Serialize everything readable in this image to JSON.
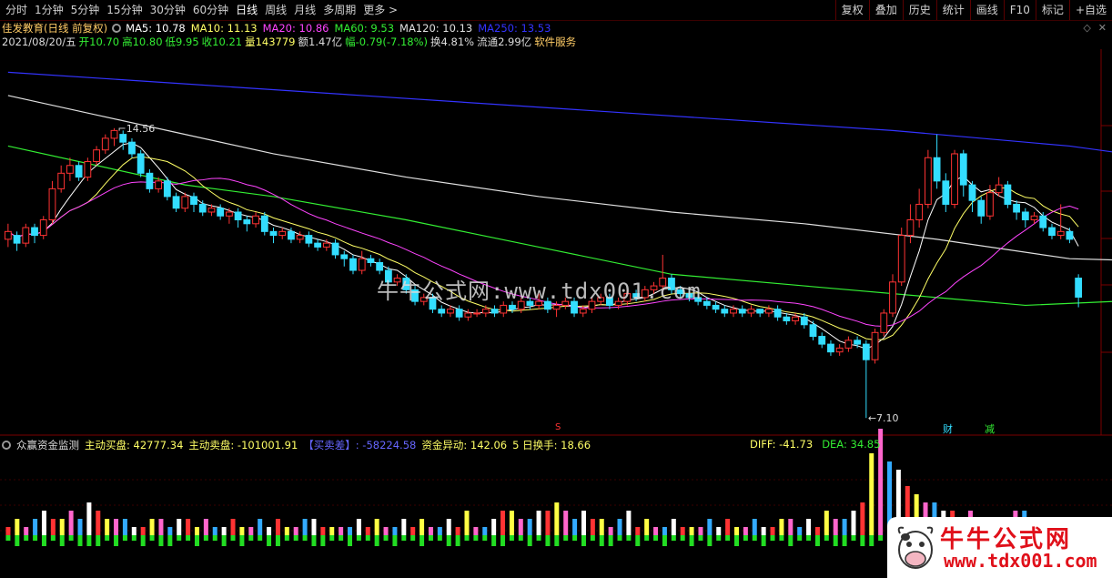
{
  "toolbar": {
    "periods": [
      "分时",
      "1分钟",
      "5分钟",
      "15分钟",
      "30分钟",
      "60分钟",
      "日线",
      "周线",
      "月线",
      "多周期",
      "更多 >"
    ],
    "active_period": "日线",
    "buttons": [
      "复权",
      "叠加",
      "历史",
      "统计",
      "画线",
      "F10",
      "标记",
      "+自选"
    ]
  },
  "stock": {
    "name": "佳发教育(日线 前复权)",
    "ma": [
      {
        "label": "MA5: 10.78",
        "color": "#ffffff"
      },
      {
        "label": "MA10: 11.13",
        "color": "#ffff66"
      },
      {
        "label": "MA20: 10.86",
        "color": "#ff44ff"
      },
      {
        "label": "MA60: 9.53",
        "color": "#33ee33"
      },
      {
        "label": "MA120: 10.13",
        "color": "#e0e0e0"
      },
      {
        "label": "MA250: 13.53",
        "color": "#3333ff"
      }
    ],
    "date": "2021/08/20/五",
    "open": "开10.70",
    "high": "高10.80",
    "low": "低9.95",
    "close": "收10.21",
    "volume": "量143779",
    "amount": "额1.47亿",
    "change": "幅-0.79(-7.18%)",
    "turnover": "换4.81%",
    "float": "流通2.99亿",
    "sector": "软件服务"
  },
  "annotations": {
    "high_label": "14.56",
    "low_label": "7.10",
    "marker_s": "S",
    "marker_bao": "财",
    "marker_jian": "减"
  },
  "watermark": "牛牛公式网:www.tdx001.com",
  "indicator": {
    "name": "众赢资金监测",
    "buy": "主动买盘: 42777.34",
    "sell": "主动卖盘: -101001.91",
    "diff_label": "【买卖差】: -58224.58",
    "flow": "资金异动: 142.06",
    "turnover5": "5 日换手: 18.66",
    "diff": "DIFF: -41.73",
    "dea": "DEA: 34.85"
  },
  "logo": {
    "brand": "牛牛公式网",
    "url": "www.tdx001.com"
  },
  "colors": {
    "up": "#ff3333",
    "down": "#33ddff",
    "ma5": "#ffffff",
    "ma10": "#ffff66",
    "ma20": "#ff44ff",
    "ma60": "#33ee33",
    "ma120": "#e0e0e0",
    "ma250": "#3333ff"
  },
  "chart_data": {
    "type": "candlestick",
    "price_range": [
      6.8,
      16.5
    ],
    "candles": [
      {
        "o": 11.7,
        "c": 11.9,
        "h": 12.1,
        "l": 11.5
      },
      {
        "o": 11.8,
        "c": 11.6,
        "h": 11.9,
        "l": 11.4
      },
      {
        "o": 11.6,
        "c": 12.0,
        "h": 12.1,
        "l": 11.5
      },
      {
        "o": 12.0,
        "c": 11.8,
        "h": 12.1,
        "l": 11.6
      },
      {
        "o": 11.8,
        "c": 12.2,
        "h": 12.3,
        "l": 11.7
      },
      {
        "o": 12.2,
        "c": 13.0,
        "h": 13.2,
        "l": 12.1
      },
      {
        "o": 13.0,
        "c": 13.4,
        "h": 13.6,
        "l": 12.9
      },
      {
        "o": 13.4,
        "c": 13.6,
        "h": 13.8,
        "l": 13.2
      },
      {
        "o": 13.6,
        "c": 13.3,
        "h": 13.7,
        "l": 13.2
      },
      {
        "o": 13.3,
        "c": 13.7,
        "h": 13.8,
        "l": 13.2
      },
      {
        "o": 13.7,
        "c": 14.0,
        "h": 14.1,
        "l": 13.6
      },
      {
        "o": 14.0,
        "c": 14.3,
        "h": 14.4,
        "l": 13.9
      },
      {
        "o": 14.3,
        "c": 14.5,
        "h": 14.56,
        "l": 14.1
      },
      {
        "o": 14.4,
        "c": 14.2,
        "h": 14.5,
        "l": 14.0
      },
      {
        "o": 14.2,
        "c": 13.9,
        "h": 14.3,
        "l": 13.8
      },
      {
        "o": 13.9,
        "c": 13.4,
        "h": 14.0,
        "l": 13.3
      },
      {
        "o": 13.4,
        "c": 13.0,
        "h": 13.5,
        "l": 12.9
      },
      {
        "o": 13.0,
        "c": 13.2,
        "h": 13.3,
        "l": 12.9
      },
      {
        "o": 13.2,
        "c": 12.8,
        "h": 13.3,
        "l": 12.7
      },
      {
        "o": 12.8,
        "c": 12.5,
        "h": 12.9,
        "l": 12.4
      },
      {
        "o": 12.5,
        "c": 12.8,
        "h": 12.9,
        "l": 12.4
      },
      {
        "o": 12.8,
        "c": 12.6,
        "h": 12.9,
        "l": 12.4
      },
      {
        "o": 12.6,
        "c": 12.4,
        "h": 12.7,
        "l": 12.3
      },
      {
        "o": 12.4,
        "c": 12.5,
        "h": 12.6,
        "l": 12.3
      },
      {
        "o": 12.5,
        "c": 12.3,
        "h": 12.6,
        "l": 12.2
      },
      {
        "o": 12.3,
        "c": 12.4,
        "h": 12.5,
        "l": 12.1
      },
      {
        "o": 12.4,
        "c": 12.2,
        "h": 12.5,
        "l": 12.0
      },
      {
        "o": 12.2,
        "c": 12.1,
        "h": 12.3,
        "l": 11.9
      },
      {
        "o": 12.1,
        "c": 12.3,
        "h": 12.4,
        "l": 12.0
      },
      {
        "o": 12.3,
        "c": 11.9,
        "h": 12.4,
        "l": 11.8
      },
      {
        "o": 11.9,
        "c": 11.8,
        "h": 12.0,
        "l": 11.6
      },
      {
        "o": 11.8,
        "c": 11.9,
        "h": 12.0,
        "l": 11.7
      },
      {
        "o": 11.9,
        "c": 11.7,
        "h": 12.0,
        "l": 11.6
      },
      {
        "o": 11.7,
        "c": 11.8,
        "h": 11.9,
        "l": 11.6
      },
      {
        "o": 11.8,
        "c": 11.6,
        "h": 11.9,
        "l": 11.5
      },
      {
        "o": 11.6,
        "c": 11.5,
        "h": 11.7,
        "l": 11.4
      },
      {
        "o": 11.5,
        "c": 11.6,
        "h": 11.7,
        "l": 11.4
      },
      {
        "o": 11.6,
        "c": 11.3,
        "h": 11.7,
        "l": 11.2
      },
      {
        "o": 11.3,
        "c": 11.2,
        "h": 11.4,
        "l": 11.0
      },
      {
        "o": 11.2,
        "c": 10.9,
        "h": 11.3,
        "l": 10.8
      },
      {
        "o": 10.9,
        "c": 11.2,
        "h": 11.4,
        "l": 10.8
      },
      {
        "o": 11.2,
        "c": 11.1,
        "h": 11.3,
        "l": 11.0
      },
      {
        "o": 11.1,
        "c": 10.9,
        "h": 11.2,
        "l": 10.8
      },
      {
        "o": 10.9,
        "c": 10.6,
        "h": 11.0,
        "l": 10.5
      },
      {
        "o": 10.6,
        "c": 10.7,
        "h": 10.8,
        "l": 10.5
      },
      {
        "o": 10.7,
        "c": 10.4,
        "h": 10.8,
        "l": 10.3
      },
      {
        "o": 10.4,
        "c": 10.1,
        "h": 10.5,
        "l": 10.0
      },
      {
        "o": 10.1,
        "c": 10.2,
        "h": 10.3,
        "l": 10.0
      },
      {
        "o": 10.2,
        "c": 9.9,
        "h": 10.3,
        "l": 9.8
      },
      {
        "o": 9.9,
        "c": 9.8,
        "h": 10.0,
        "l": 9.7
      },
      {
        "o": 9.8,
        "c": 9.9,
        "h": 10.0,
        "l": 9.7
      },
      {
        "o": 9.9,
        "c": 9.7,
        "h": 10.0,
        "l": 9.6
      },
      {
        "o": 9.7,
        "c": 9.8,
        "h": 9.9,
        "l": 9.6
      },
      {
        "o": 9.8,
        "c": 9.8,
        "h": 9.9,
        "l": 9.7
      },
      {
        "o": 9.8,
        "c": 9.9,
        "h": 10.0,
        "l": 9.7
      },
      {
        "o": 9.9,
        "c": 9.8,
        "h": 10.0,
        "l": 9.7
      },
      {
        "o": 9.8,
        "c": 10.0,
        "h": 10.1,
        "l": 9.7
      },
      {
        "o": 10.0,
        "c": 9.9,
        "h": 10.1,
        "l": 9.8
      },
      {
        "o": 9.9,
        "c": 10.1,
        "h": 10.2,
        "l": 9.8
      },
      {
        "o": 10.1,
        "c": 10.0,
        "h": 10.2,
        "l": 9.9
      },
      {
        "o": 10.0,
        "c": 10.1,
        "h": 10.3,
        "l": 9.9
      },
      {
        "o": 10.1,
        "c": 9.9,
        "h": 10.2,
        "l": 9.8
      },
      {
        "o": 9.9,
        "c": 10.0,
        "h": 10.1,
        "l": 9.7
      },
      {
        "o": 10.0,
        "c": 10.1,
        "h": 10.2,
        "l": 9.9
      },
      {
        "o": 10.1,
        "c": 9.8,
        "h": 10.2,
        "l": 9.7
      },
      {
        "o": 9.8,
        "c": 9.9,
        "h": 10.0,
        "l": 9.7
      },
      {
        "o": 9.9,
        "c": 10.1,
        "h": 10.2,
        "l": 9.8
      },
      {
        "o": 10.1,
        "c": 10.2,
        "h": 10.3,
        "l": 10.0
      },
      {
        "o": 10.2,
        "c": 10.0,
        "h": 10.3,
        "l": 9.9
      },
      {
        "o": 10.0,
        "c": 10.1,
        "h": 10.2,
        "l": 9.9
      },
      {
        "o": 10.1,
        "c": 10.3,
        "h": 10.4,
        "l": 10.0
      },
      {
        "o": 10.3,
        "c": 10.2,
        "h": 10.4,
        "l": 10.1
      },
      {
        "o": 10.2,
        "c": 10.4,
        "h": 10.5,
        "l": 10.1
      },
      {
        "o": 10.4,
        "c": 10.5,
        "h": 10.6,
        "l": 10.3
      },
      {
        "o": 10.5,
        "c": 10.7,
        "h": 11.3,
        "l": 10.4
      },
      {
        "o": 10.7,
        "c": 10.4,
        "h": 10.8,
        "l": 10.3
      },
      {
        "o": 10.4,
        "c": 10.3,
        "h": 10.5,
        "l": 10.2
      },
      {
        "o": 10.3,
        "c": 10.2,
        "h": 10.4,
        "l": 10.1
      },
      {
        "o": 10.2,
        "c": 10.1,
        "h": 10.3,
        "l": 10.0
      },
      {
        "o": 10.1,
        "c": 10.0,
        "h": 10.2,
        "l": 9.9
      },
      {
        "o": 10.0,
        "c": 9.9,
        "h": 10.1,
        "l": 9.8
      },
      {
        "o": 9.9,
        "c": 9.8,
        "h": 10.0,
        "l": 9.7
      },
      {
        "o": 9.8,
        "c": 9.9,
        "h": 10.0,
        "l": 9.7
      },
      {
        "o": 9.9,
        "c": 9.8,
        "h": 10.0,
        "l": 9.7
      },
      {
        "o": 9.8,
        "c": 9.9,
        "h": 10.0,
        "l": 9.7
      },
      {
        "o": 9.9,
        "c": 9.8,
        "h": 9.9,
        "l": 9.7
      },
      {
        "o": 9.8,
        "c": 9.9,
        "h": 10.0,
        "l": 9.7
      },
      {
        "o": 9.9,
        "c": 9.7,
        "h": 10.0,
        "l": 9.6
      },
      {
        "o": 9.7,
        "c": 9.6,
        "h": 9.8,
        "l": 9.5
      },
      {
        "o": 9.6,
        "c": 9.7,
        "h": 9.8,
        "l": 9.5
      },
      {
        "o": 9.7,
        "c": 9.5,
        "h": 9.8,
        "l": 9.4
      },
      {
        "o": 9.5,
        "c": 9.2,
        "h": 9.6,
        "l": 9.1
      },
      {
        "o": 9.2,
        "c": 9.0,
        "h": 9.3,
        "l": 8.9
      },
      {
        "o": 9.0,
        "c": 8.8,
        "h": 9.1,
        "l": 8.7
      },
      {
        "o": 8.8,
        "c": 8.9,
        "h": 9.0,
        "l": 8.7
      },
      {
        "o": 8.9,
        "c": 9.1,
        "h": 9.2,
        "l": 8.8
      },
      {
        "o": 9.1,
        "c": 9.0,
        "h": 9.2,
        "l": 8.9
      },
      {
        "o": 9.0,
        "c": 8.6,
        "h": 9.1,
        "l": 7.1
      },
      {
        "o": 8.6,
        "c": 9.3,
        "h": 9.4,
        "l": 8.5
      },
      {
        "o": 9.3,
        "c": 9.8,
        "h": 9.9,
        "l": 9.2
      },
      {
        "o": 9.8,
        "c": 10.6,
        "h": 10.8,
        "l": 9.7
      },
      {
        "o": 10.6,
        "c": 11.8,
        "h": 12.0,
        "l": 10.5
      },
      {
        "o": 11.8,
        "c": 12.2,
        "h": 12.6,
        "l": 11.6
      },
      {
        "o": 12.2,
        "c": 12.6,
        "h": 13.0,
        "l": 12.0
      },
      {
        "o": 12.6,
        "c": 13.8,
        "h": 14.0,
        "l": 12.5
      },
      {
        "o": 13.8,
        "c": 13.2,
        "h": 14.4,
        "l": 13.0
      },
      {
        "o": 13.2,
        "c": 12.6,
        "h": 13.4,
        "l": 12.4
      },
      {
        "o": 12.6,
        "c": 13.9,
        "h": 14.0,
        "l": 12.5
      },
      {
        "o": 13.9,
        "c": 13.1,
        "h": 14.0,
        "l": 12.8
      },
      {
        "o": 13.1,
        "c": 12.7,
        "h": 13.2,
        "l": 12.4
      },
      {
        "o": 12.7,
        "c": 12.3,
        "h": 12.8,
        "l": 12.1
      },
      {
        "o": 12.3,
        "c": 12.9,
        "h": 13.1,
        "l": 12.2
      },
      {
        "o": 12.9,
        "c": 13.1,
        "h": 13.3,
        "l": 12.8
      },
      {
        "o": 13.1,
        "c": 12.6,
        "h": 13.2,
        "l": 12.5
      },
      {
        "o": 12.6,
        "c": 12.4,
        "h": 12.7,
        "l": 12.2
      },
      {
        "o": 12.4,
        "c": 12.2,
        "h": 12.5,
        "l": 12.0
      },
      {
        "o": 12.2,
        "c": 12.3,
        "h": 12.4,
        "l": 12.1
      },
      {
        "o": 12.3,
        "c": 12.0,
        "h": 12.4,
        "l": 11.9
      },
      {
        "o": 12.0,
        "c": 11.8,
        "h": 12.1,
        "l": 11.7
      },
      {
        "o": 11.8,
        "c": 11.9,
        "h": 12.6,
        "l": 11.7
      },
      {
        "o": 11.9,
        "c": 11.7,
        "h": 12.0,
        "l": 11.6
      },
      {
        "o": 10.7,
        "c": 10.21,
        "h": 10.8,
        "l": 9.95
      }
    ],
    "ma_series": [
      {
        "name": "MA250",
        "color": "#3333ff",
        "points": [
          [
            0,
            16.0
          ],
          [
            20,
            15.7
          ],
          [
            40,
            15.4
          ],
          [
            60,
            15.1
          ],
          [
            80,
            14.8
          ],
          [
            100,
            14.5
          ],
          [
            120,
            14.1
          ],
          [
            136,
            13.6
          ]
        ]
      },
      {
        "name": "MA120",
        "color": "#e0e0e0",
        "points": [
          [
            0,
            15.4
          ],
          [
            10,
            14.9
          ],
          [
            20,
            14.4
          ],
          [
            30,
            13.9
          ],
          [
            45,
            13.3
          ],
          [
            60,
            12.8
          ],
          [
            75,
            12.4
          ],
          [
            90,
            12.1
          ],
          [
            105,
            11.7
          ],
          [
            120,
            11.2
          ],
          [
            136,
            11.1
          ]
        ]
      },
      {
        "name": "MA60",
        "color": "#33ee33",
        "points": [
          [
            0,
            14.1
          ],
          [
            10,
            13.6
          ],
          [
            20,
            13.1
          ],
          [
            30,
            12.8
          ],
          [
            45,
            12.2
          ],
          [
            60,
            11.5
          ],
          [
            75,
            10.8
          ],
          [
            90,
            10.5
          ],
          [
            105,
            10.2
          ],
          [
            115,
            10.0
          ],
          [
            125,
            10.1
          ],
          [
            136,
            10.5
          ]
        ]
      }
    ],
    "volume_bars": {
      "pos": [
        1,
        2,
        1,
        2,
        3,
        2,
        2,
        3,
        2,
        4,
        3,
        2,
        2,
        2,
        1,
        1,
        2,
        2,
        1,
        2,
        2,
        1,
        2,
        1,
        1,
        2,
        1,
        1,
        2,
        1,
        2,
        1,
        1,
        2,
        2,
        1,
        1,
        1,
        1,
        2,
        1,
        2,
        1,
        1,
        2,
        1,
        2,
        1,
        1,
        2,
        1,
        3,
        1,
        1,
        2,
        3,
        3,
        2,
        2,
        3,
        3,
        4,
        3,
        2,
        3,
        2,
        2,
        1,
        2,
        3,
        1,
        2,
        1,
        1,
        2,
        1,
        1,
        1,
        2,
        1,
        2,
        1,
        1,
        2,
        1,
        1,
        2,
        2,
        1,
        2,
        1,
        3,
        2,
        2,
        3,
        4,
        10,
        13,
        9,
        8,
        6,
        5,
        4,
        4,
        3,
        3,
        2,
        3,
        2,
        2,
        2,
        1,
        3,
        3,
        1,
        2,
        1,
        1,
        2,
        1
      ],
      "neg": [
        1,
        2,
        1,
        1,
        2,
        1,
        2,
        1,
        2,
        2,
        2,
        1,
        2,
        1,
        1,
        2,
        1,
        2,
        2,
        1,
        1,
        2,
        1,
        1,
        2,
        1,
        2,
        1,
        1,
        2,
        2,
        1,
        1,
        1,
        2,
        2,
        1,
        1,
        2,
        1,
        1,
        2,
        1,
        2,
        1,
        1,
        2,
        1,
        1,
        2,
        2,
        1,
        1,
        1,
        2,
        2,
        1,
        1,
        2,
        1,
        2,
        2,
        1,
        1,
        2,
        1,
        2,
        2,
        1,
        1,
        2,
        1,
        1,
        2,
        1,
        1,
        2,
        1,
        2,
        1,
        1,
        2,
        1,
        1,
        2,
        1,
        1,
        2,
        1,
        1,
        2,
        1,
        2,
        2,
        1,
        2,
        2,
        1,
        2,
        1,
        2,
        1,
        1,
        2,
        1,
        1,
        2,
        1,
        1,
        2,
        1,
        1,
        1,
        2,
        1,
        1,
        2,
        1,
        1,
        1
      ]
    }
  }
}
